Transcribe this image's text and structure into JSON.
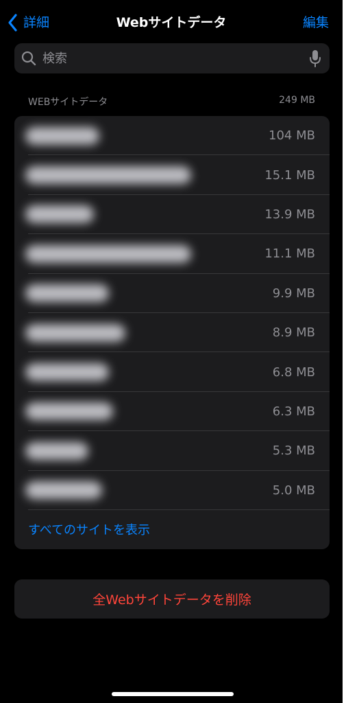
{
  "nav": {
    "back_label": "詳細",
    "title": "Webサイトデータ",
    "edit_label": "編集"
  },
  "search": {
    "placeholder": "検索",
    "icon": "magnifier-icon",
    "mic_icon": "microphone-icon"
  },
  "section": {
    "header": "WEBサイトデータ",
    "total": "249 MB"
  },
  "sites": [
    {
      "size": "104 MB"
    },
    {
      "size": "15.1 MB"
    },
    {
      "size": "13.9 MB"
    },
    {
      "size": "11.1 MB"
    },
    {
      "size": "9.9 MB"
    },
    {
      "size": "8.9 MB"
    },
    {
      "size": "6.8 MB"
    },
    {
      "size": "6.3 MB"
    },
    {
      "size": "5.3 MB"
    },
    {
      "size": "5.0 MB"
    }
  ],
  "show_all_label": "すべてのサイトを表示",
  "delete_label": "全Webサイトデータを削除",
  "colors": {
    "accent": "#0a84ff",
    "destructive": "#ff453a",
    "background": "#000000",
    "cell": "#1c1c1e",
    "secondary_text": "#8e8e93"
  }
}
